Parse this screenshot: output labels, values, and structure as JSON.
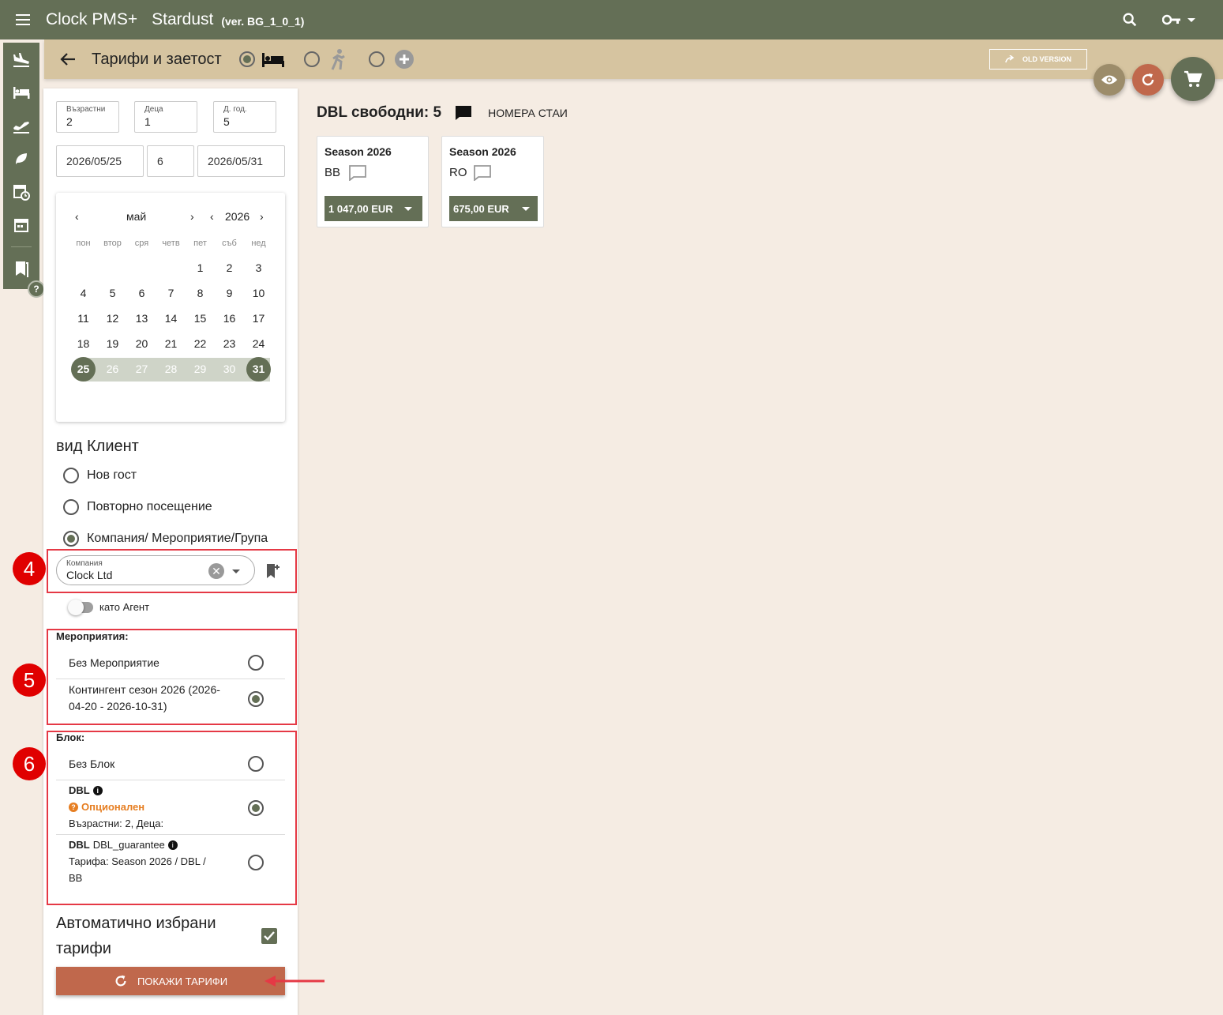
{
  "topbar": {
    "app_name": "Clock PMS+",
    "hotel": "Stardust",
    "version": "(ver. BG_1_0_1)"
  },
  "subbar": {
    "title": "Тарифи и заетост",
    "old_version": "OLD VERSION"
  },
  "guests": {
    "adults_label": "Възрастни",
    "adults": "2",
    "children_label": "Деца",
    "children": "1",
    "age_label": "Д. год.",
    "age": "5"
  },
  "dates": {
    "arrival": "2026/05/25",
    "nights": "6",
    "departure": "2026/05/31"
  },
  "calendar": {
    "month": "май",
    "year": "2026",
    "weekdays": [
      "пон",
      "втор",
      "сря",
      "четв",
      "пет",
      "съб",
      "нед"
    ],
    "days": [
      "1",
      "2",
      "3",
      "4",
      "5",
      "6",
      "7",
      "8",
      "9",
      "10",
      "11",
      "12",
      "13",
      "14",
      "15",
      "16",
      "17",
      "18",
      "19",
      "20",
      "21",
      "22",
      "23",
      "24",
      "25",
      "26",
      "27",
      "28",
      "29",
      "30",
      "31"
    ],
    "range_start": "25",
    "range_end": "31"
  },
  "client_type": {
    "title": "вид Клиент",
    "options": [
      "Нов гост",
      "Повторно посещение",
      "Компания/ Мероприятие/Група"
    ],
    "selected": 2
  },
  "company": {
    "label": "Компания",
    "value": "Clock Ltd",
    "agent_label": "като Агент"
  },
  "events": {
    "title": "Мероприятия:",
    "none": "Без Мероприятие",
    "contingent_line1": "Контингент сезон 2026 (2026-",
    "contingent_line2": "04-20 - 2026-10-31)"
  },
  "blocks": {
    "title": "Блок:",
    "none": "Без Блок",
    "b1_name": "DBL",
    "b1_status": "Опционален",
    "b1_detail": "Възрастни: 2, Деца:",
    "b2_name": "DBL",
    "b2_sub": "DBL_guarantee",
    "b2_line1": "Тарифа: Season 2026 / DBL /",
    "b2_line2": "BB"
  },
  "auto": {
    "line1": "Автоматично избрани",
    "line2": "тарифи"
  },
  "show_button": "ПОКАЖИ ТАРИФИ",
  "badges": [
    "4",
    "5",
    "6"
  ],
  "results": {
    "header": "DBL свободни: 5",
    "rooms_link": "НОМЕРА СТАИ",
    "cards": [
      {
        "season": "Season 2026",
        "board": "BB",
        "price": "1 047,00 EUR"
      },
      {
        "season": "Season 2026",
        "board": "RO",
        "price": "675,00 EUR"
      }
    ]
  },
  "colors": {
    "primary": "#646f56",
    "accent": "#c0684c",
    "highlight": "#e53945",
    "warning": "#e67e22"
  }
}
